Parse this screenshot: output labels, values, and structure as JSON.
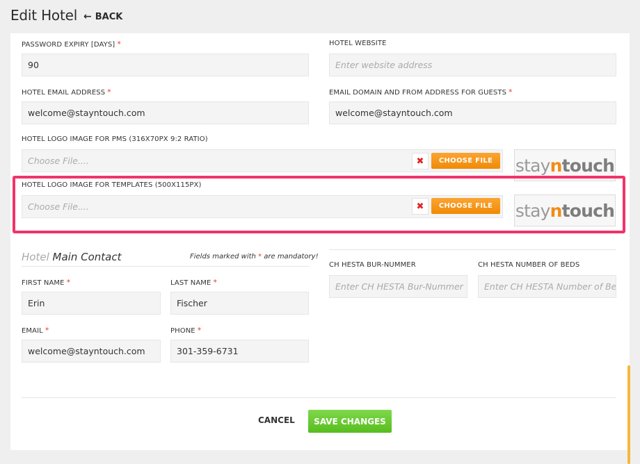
{
  "header": {
    "title": "Edit Hotel",
    "back_label": "BACK"
  },
  "fields": {
    "password_expiry": {
      "label": "PASSWORD EXPIRY [DAYS]",
      "value": "90"
    },
    "hotel_website": {
      "label": "HOTEL WEBSITE",
      "placeholder": "Enter website address"
    },
    "hotel_email": {
      "label": "HOTEL EMAIL ADDRESS",
      "value": "welcome@stayntouch.com"
    },
    "email_domain": {
      "label": "EMAIL DOMAIN AND FROM ADDRESS FOR GUESTS",
      "value": "welcome@stayntouch.com"
    },
    "logo_pms": {
      "label": "HOTEL LOGO IMAGE FOR PMS (316X70PX 9:2 RATIO)",
      "placeholder": "Choose File....",
      "button": "CHOOSE FILE",
      "clear": "✖"
    },
    "logo_templates": {
      "label": "HOTEL LOGO IMAGE FOR TEMPLATES (500X115PX)",
      "placeholder": "Choose File....",
      "button": "CHOOSE FILE",
      "clear": "✖"
    }
  },
  "logo": {
    "part1": "stay",
    "part2": "n",
    "part3": "touch"
  },
  "contact": {
    "title_light": "Hotel",
    "title_main": "Main Contact",
    "note_before": "Fields marked with",
    "note_star": "*",
    "note_after": "are mandatory!",
    "first_name": {
      "label": "FIRST NAME",
      "value": "Erin"
    },
    "last_name": {
      "label": "LAST NAME",
      "value": "Fischer"
    },
    "email": {
      "label": "EMAIL",
      "value": "welcome@stayntouch.com"
    },
    "phone": {
      "label": "PHONE",
      "value": "301-359-6731"
    }
  },
  "ch_hesta": {
    "bur_nummer": {
      "label": "CH HESTA BUR-NUMMER",
      "placeholder": "Enter CH HESTA Bur-Nummer"
    },
    "beds": {
      "label": "CH HESTA NUMBER OF BEDS",
      "placeholder": "Enter CH HESTA Number of Beds"
    }
  },
  "required_mark": "*",
  "actions": {
    "cancel": "CANCEL",
    "save": "SAVE CHANGES"
  },
  "colors": {
    "accent_orange": "#f08a06",
    "save_green": "#57bd1e",
    "required_red": "#e63a2a",
    "highlight_pink": "#f2336a"
  }
}
